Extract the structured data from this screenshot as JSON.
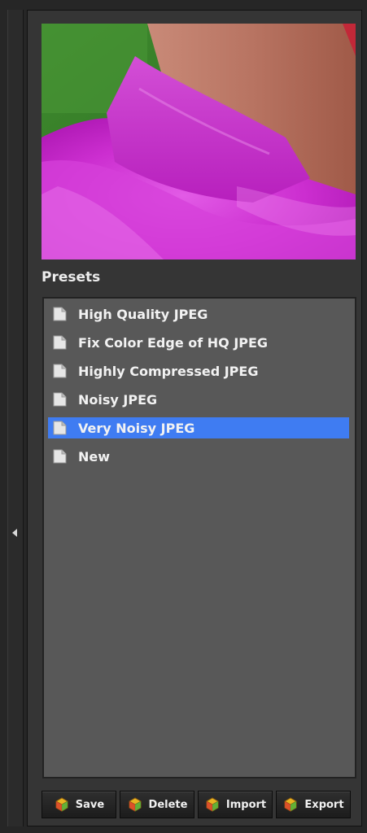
{
  "panel": {
    "preview_alt": "",
    "presets_label": "Presets",
    "items": [
      {
        "label": "High Quality JPEG",
        "selected": false
      },
      {
        "label": "Fix Color Edge of HQ JPEG",
        "selected": false
      },
      {
        "label": "Highly Compressed JPEG",
        "selected": false
      },
      {
        "label": "Noisy JPEG",
        "selected": false
      },
      {
        "label": "Very Noisy JPEG",
        "selected": true
      },
      {
        "label": "New",
        "selected": false
      }
    ],
    "buttons": {
      "save": "Save",
      "delete": "Delete",
      "import": "Import",
      "export": "Export"
    }
  },
  "colors": {
    "selection": "#3f7cf2",
    "list_bg": "#585858",
    "panel_bg": "#353535"
  },
  "icons": {
    "collapse": "triangle-left-icon",
    "preset_item": "document-icon",
    "buttons": "gem-icon"
  }
}
